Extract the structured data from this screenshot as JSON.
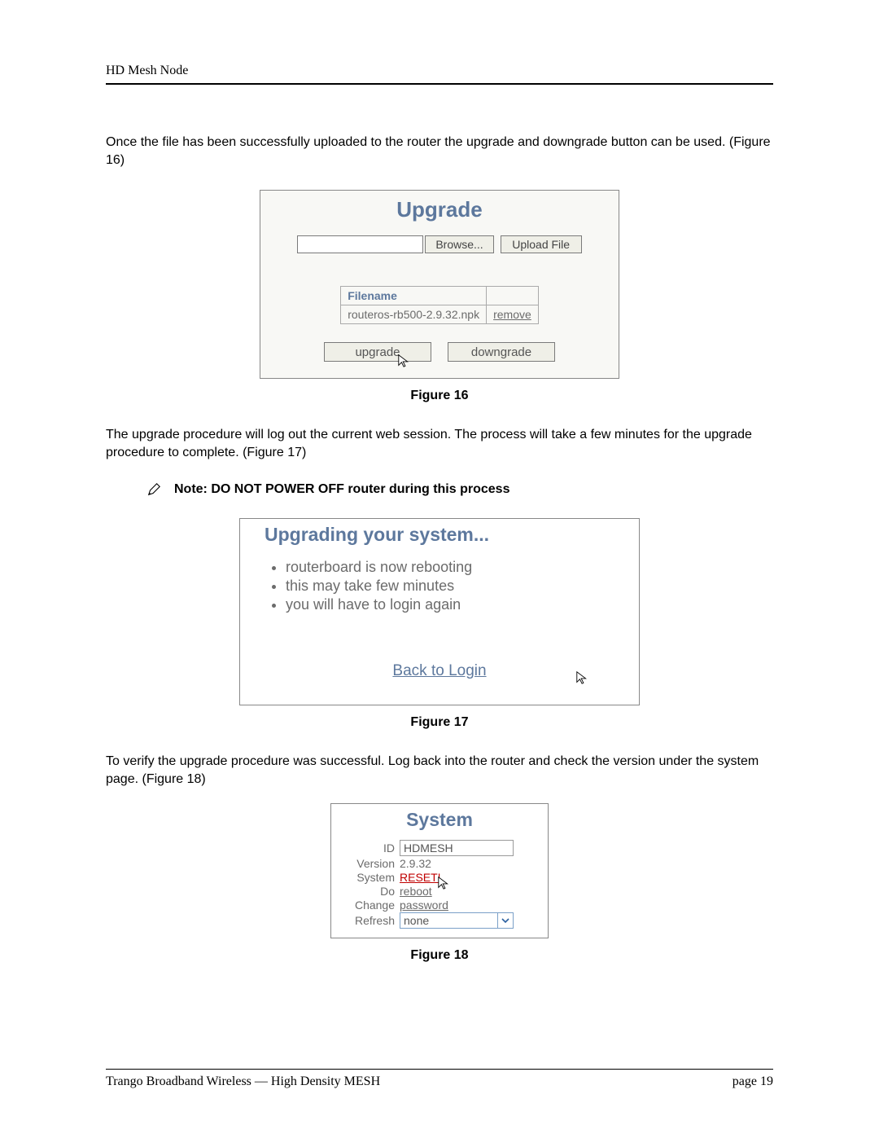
{
  "header": {
    "title": "HD Mesh Node"
  },
  "para1": "Once the file has been successfully uploaded to the router the upgrade and downgrade button can be used. (Figure 16)",
  "fig16": {
    "title": "Upgrade",
    "browse": "Browse...",
    "upload": "Upload File",
    "filename_header": "Filename",
    "filename_value": "routeros-rb500-2.9.32.npk",
    "remove": "remove",
    "upgrade_btn": "upgrade",
    "downgrade_btn": "downgrade",
    "caption": "Figure 16"
  },
  "para2": "The upgrade procedure will log out the current web session. The process will take a few minutes for the upgrade procedure to complete. (Figure 17)",
  "note": "Note: DO NOT POWER OFF router during this process",
  "fig17": {
    "title": "Upgrading your system...",
    "bullets": [
      "routerboard is now rebooting",
      "this may take few minutes",
      "you will have to login again"
    ],
    "back": "Back to Login",
    "caption": "Figure 17"
  },
  "para3": "To verify the upgrade procedure was successful. Log back into the router and check the version under the system page. (Figure 18)",
  "fig18": {
    "title": "System",
    "rows": {
      "id_label": "ID",
      "id_value": "HDMESH",
      "version_label": "Version",
      "version_value": "2.9.32",
      "system_label": "System",
      "system_value": "RESET!",
      "do_label": "Do",
      "do_value": "reboot",
      "change_label": "Change",
      "change_value": "password",
      "refresh_label": "Refresh",
      "refresh_value": "none"
    },
    "caption": "Figure 18"
  },
  "footer": {
    "left": "Trango Broadband Wireless — High Density MESH",
    "right": "page 19"
  }
}
